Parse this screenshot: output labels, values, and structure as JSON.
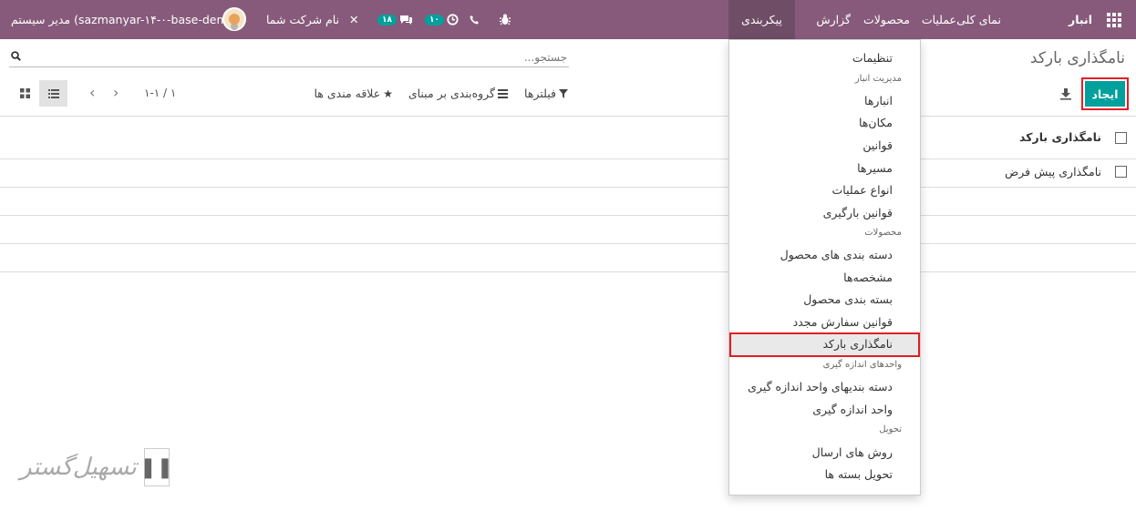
{
  "topbar": {
    "brand": "انبار",
    "menu": {
      "overview": "نمای کلی",
      "operations": "عملیات",
      "products": "محصولات",
      "reporting": "گزارش",
      "configuration": "پیکربندی"
    },
    "db_user": "مدیر سیستم (sazmanyar-۱۴-۰-base-demo)",
    "company": "نام شرکت شما",
    "messages_count": "۱۸",
    "activities_count": "۱۰"
  },
  "page": {
    "title": "نامگذاری بارکد",
    "create_label": "ایجاد",
    "search_placeholder": "جستجو...",
    "filters_label": "فیلترها",
    "groupby_label": "گروه‌بندی بر مبنای",
    "favorites_label": "علاقه مندی ها",
    "pager": "۱-۱ / ۱"
  },
  "list": {
    "column_header": "نامگذاری بارکد",
    "rows": [
      "نامگذاری پیش فرض"
    ]
  },
  "config_menu": {
    "settings": "تنظیمات",
    "section_warehouse": "مدیریت انبار",
    "warehouses": "انبارها",
    "locations": "مکان‌ها",
    "rules": "قوانین",
    "routes": "مسیرها",
    "operation_types": "انواع عملیات",
    "putaway_rules": "قوانین بارگیری",
    "section_products": "محصولات",
    "product_categories": "دسته بندی های محصول",
    "attributes": "مشخصه‌ها",
    "product_packagings": "بسته بندی محصول",
    "reordering_rules": "قوانین سفارش مجدد",
    "barcode_nomenclatures": "نامگذاری بارکد",
    "section_uom": "واحدهای اندازه گیری",
    "uom_categories": "دسته بندیهای واحد اندازه گیری",
    "uom": "واحد اندازه گیری",
    "section_delivery": "تحویل",
    "shipping_methods": "روش های ارسال",
    "delivery_packages": "تحویل بسته ها"
  },
  "watermark": {
    "text": "تسهیل‌گستر"
  }
}
